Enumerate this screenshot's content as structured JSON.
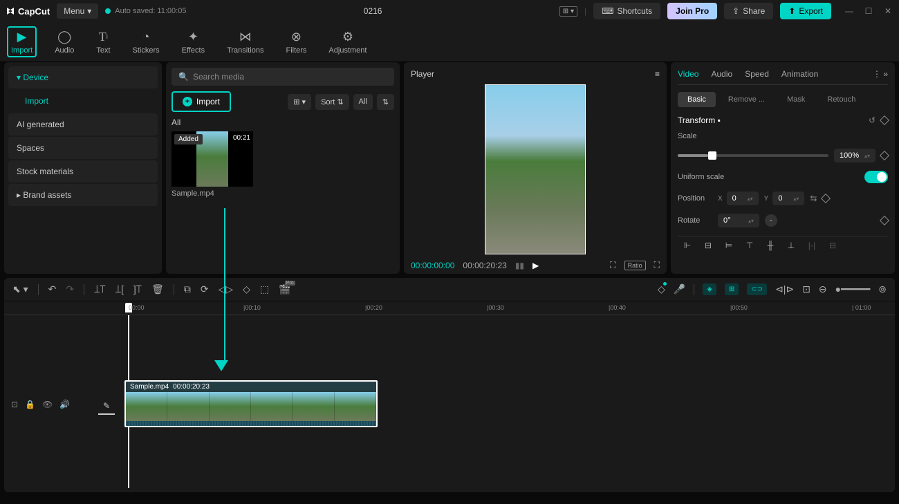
{
  "titlebar": {
    "logo": "CapCut",
    "menu": "Menu",
    "autosave": "Auto saved: 11:00:05",
    "project": "0216",
    "shortcuts": "Shortcuts",
    "join_pro": "Join Pro",
    "share": "Share",
    "export": "Export"
  },
  "toolbar": {
    "import": "Import",
    "audio": "Audio",
    "text": "Text",
    "stickers": "Stickers",
    "effects": "Effects",
    "transitions": "Transitions",
    "filters": "Filters",
    "adjustment": "Adjustment"
  },
  "sidebar": {
    "device": "Device",
    "import": "Import",
    "ai": "AI generated",
    "spaces": "Spaces",
    "stock": "Stock materials",
    "brand": "Brand assets"
  },
  "media": {
    "search_placeholder": "Search media",
    "import": "Import",
    "sort": "Sort",
    "all_btn": "All",
    "all_label": "All",
    "clip": {
      "added": "Added",
      "time": "00:21",
      "name": "Sample.mp4"
    }
  },
  "player": {
    "title": "Player",
    "current": "00:00:00:00",
    "total": "00:00:20:23",
    "ratio": "Ratio"
  },
  "inspector": {
    "tabs": {
      "video": "Video",
      "audio": "Audio",
      "speed": "Speed",
      "animation": "Animation"
    },
    "subtabs": {
      "basic": "Basic",
      "remove": "Remove ...",
      "mask": "Mask",
      "retouch": "Retouch"
    },
    "transform": "Transform",
    "scale": "Scale",
    "scale_value": "100%",
    "uniform": "Uniform scale",
    "position": "Position",
    "pos_x": "0",
    "pos_y": "0",
    "rotate": "Rotate",
    "rotate_value": "0°"
  },
  "timeline": {
    "start": "00:00",
    "marks": [
      "|00:10",
      "|00:20",
      "|00:30",
      "|00:40",
      "|00:50",
      "| 01:00"
    ],
    "clip_name": "Sample.mp4",
    "clip_time": "00:00:20:23"
  }
}
